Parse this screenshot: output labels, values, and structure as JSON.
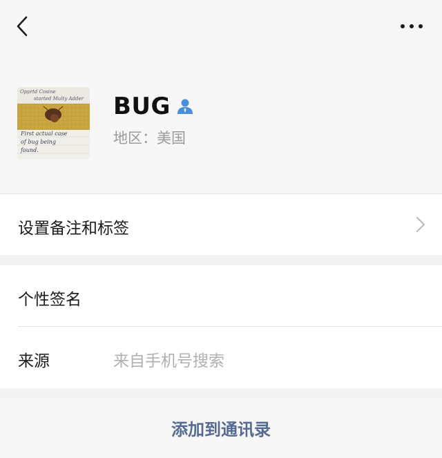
{
  "nav": {
    "back_icon": "chevron-left-icon",
    "more_icon": "more-horizontal-icon"
  },
  "profile": {
    "name": "BUG",
    "verified_icon": "user-icon",
    "region": "地区：美国",
    "avatar": {
      "lines": [
        "First actual case",
        "of bug being",
        "found."
      ],
      "header_lines": [
        "Opprtd Cosine",
        "started Multy Adder"
      ]
    }
  },
  "menu": {
    "remark_label": "设置备注和标签",
    "signature_label": "个性签名",
    "source_label": "来源",
    "source_value": "来自手机号搜索"
  },
  "actions": {
    "add_contact_label": "添加到通讯录"
  },
  "colors": {
    "link": "#566b94",
    "icon_blue": "#4a8ee0",
    "muted_text": "#9a9a9a",
    "background": "#f2f2f2"
  }
}
